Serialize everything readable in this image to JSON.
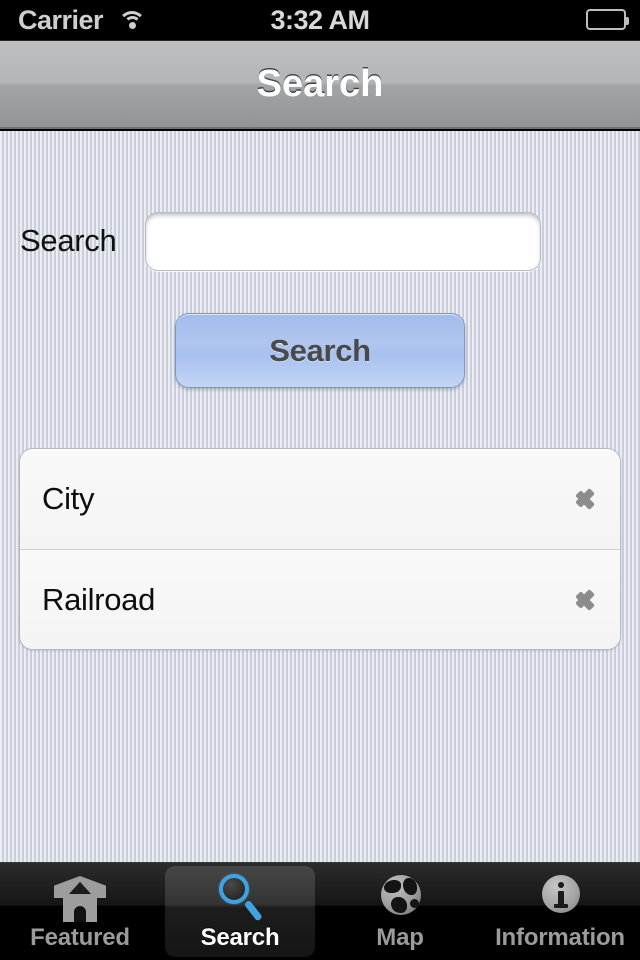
{
  "status_bar": {
    "carrier": "Carrier",
    "wifi_icon": "wifi-icon",
    "time": "3:32 AM",
    "battery_icon": "battery-icon"
  },
  "nav_bar": {
    "title": "Search"
  },
  "form": {
    "search_label": "Search",
    "search_value": "",
    "search_placeholder": "",
    "submit_label": "Search"
  },
  "list": {
    "rows": [
      {
        "label": "City",
        "accessory": "chevron-right-icon"
      },
      {
        "label": "Railroad",
        "accessory": "chevron-right-icon"
      }
    ]
  },
  "tab_bar": {
    "items": [
      {
        "label": "Featured",
        "icon": "house-icon",
        "active": false
      },
      {
        "label": "Search",
        "icon": "magnifier-icon",
        "active": true
      },
      {
        "label": "Map",
        "icon": "globe-icon",
        "active": false
      },
      {
        "label": "Information",
        "icon": "info-icon",
        "active": false
      }
    ]
  },
  "colors": {
    "accent_blue": "#3fa3e3",
    "button_blue": "#a8c0ee",
    "background": "#d5dae4",
    "navbar_gray": "#b4b5b6",
    "tabbar_black": "#000000",
    "row_background": "#f6f6f6",
    "chevron_gray": "#8c8c8c",
    "label_gray": "#9b9b9b"
  }
}
